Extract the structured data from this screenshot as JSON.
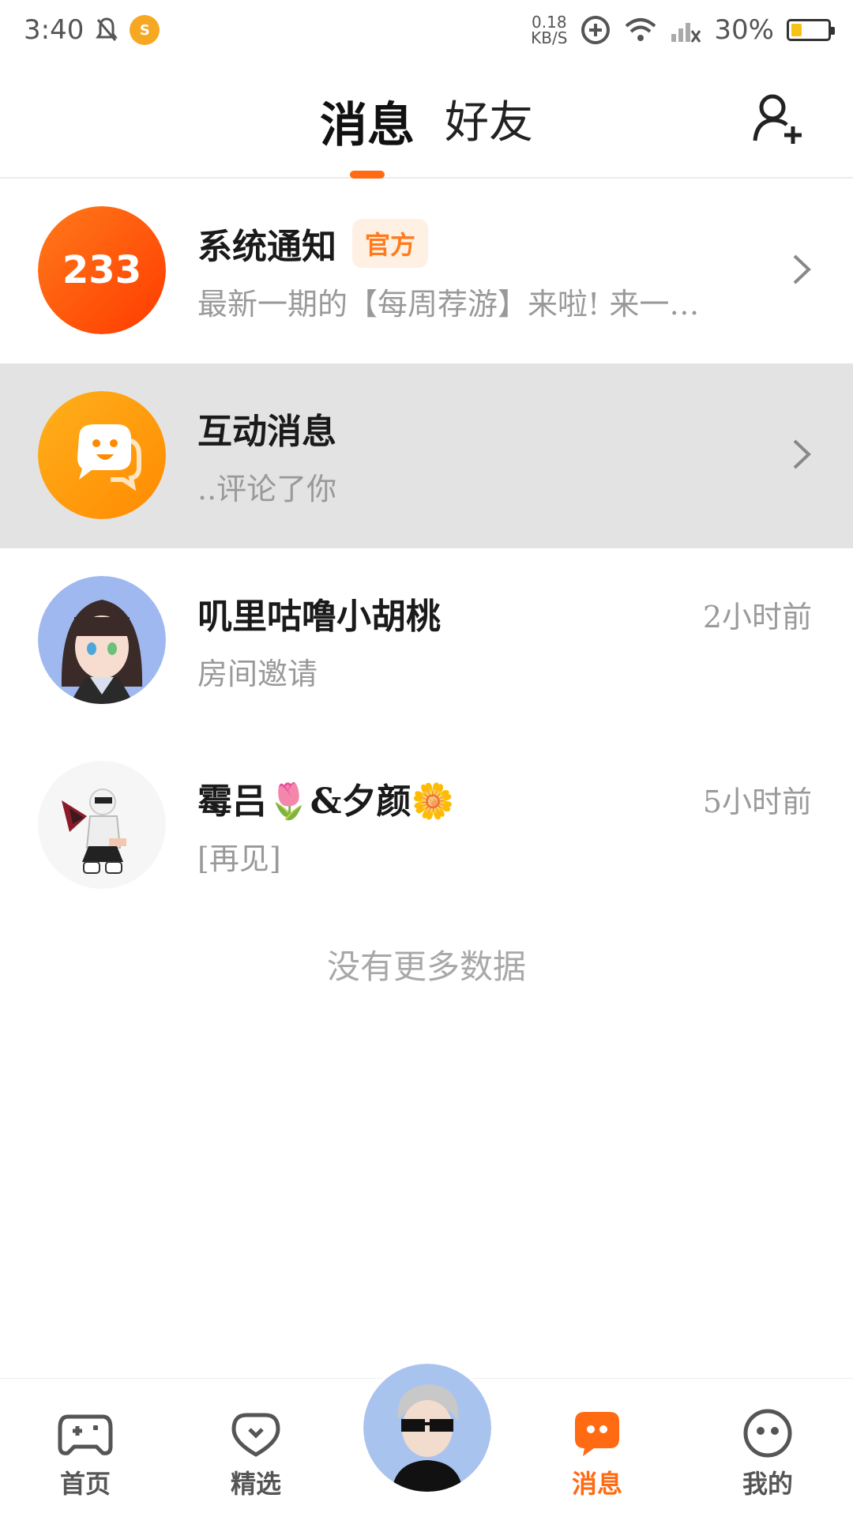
{
  "status_bar": {
    "time": "3:40",
    "net_speed_value": "0.18",
    "net_speed_unit": "KB/S",
    "battery_percent": "30%",
    "battery_level": 0.3
  },
  "header": {
    "tabs": [
      {
        "label": "消息",
        "active": true
      },
      {
        "label": "好友",
        "active": false
      }
    ],
    "add_friend_icon": "add-user-icon"
  },
  "conversations": [
    {
      "title": "系统通知",
      "badge": "官方",
      "subtitle": "最新一期的【每周荐游】来啦! 来一…",
      "avatar_text": "233",
      "avatar_icon": "app-logo-icon",
      "has_chevron": true
    },
    {
      "title": "互动消息",
      "subtitle": "..评论了你",
      "avatar_icon": "chat-bubble-smile-icon",
      "has_chevron": true
    },
    {
      "title": "叽里咕噜小胡桃",
      "subtitle": "房间邀请",
      "time": "2小时前",
      "avatar_icon": "anime-girl-avatar"
    },
    {
      "title": "霉吕🌷&夕颜🌼",
      "subtitle": "[再见]",
      "time": "5小时前",
      "avatar_icon": "anime-character-avatar"
    }
  ],
  "no_more_text": "没有更多数据",
  "bottom_nav": {
    "items": [
      {
        "label": "首页",
        "icon": "gamepad-icon",
        "active": false
      },
      {
        "label": "精选",
        "icon": "heart-badge-icon",
        "active": false
      },
      {
        "label": "消息",
        "icon": "message-icon",
        "active": true
      },
      {
        "label": "我的",
        "icon": "smiley-icon",
        "active": false
      }
    ],
    "center_avatar_icon": "user-avatar"
  },
  "colors": {
    "accent": "#ff6a13",
    "highlight_row": "#e3e3e3",
    "official_badge_bg": "#fff0e4"
  }
}
